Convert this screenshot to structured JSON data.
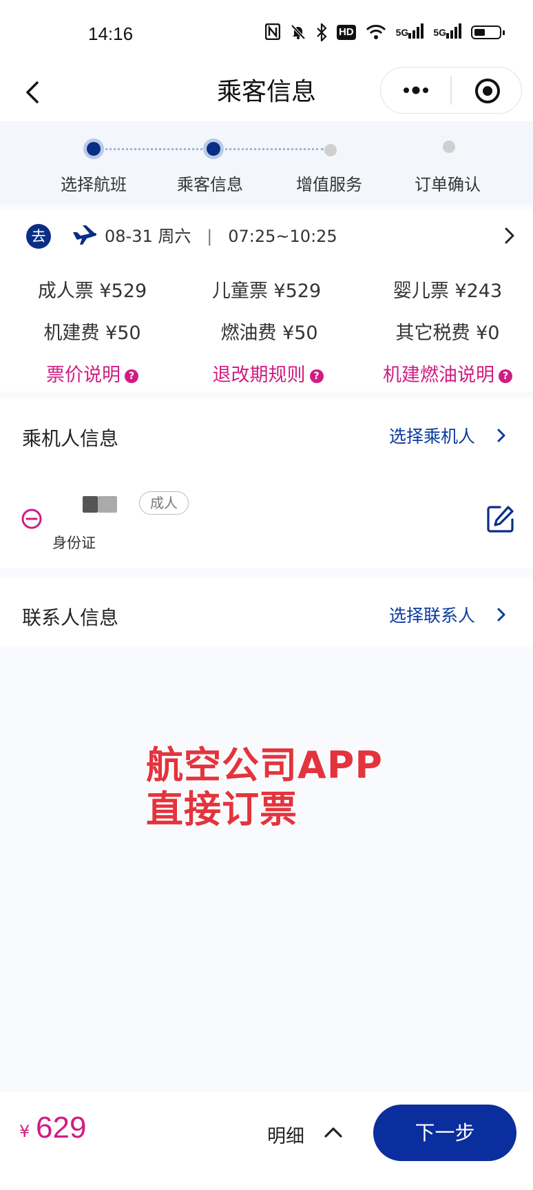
{
  "status_bar": {
    "time": "14:16",
    "icons": [
      "nfc-icon",
      "mute-icon",
      "bluetooth-icon",
      "hd-icon",
      "wifi-icon",
      "5g-signal-icon",
      "5g-signal-icon",
      "battery-icon"
    ],
    "hd_label": "HD",
    "net1": "5G",
    "net2": "5G",
    "battery_level": 0.45
  },
  "nav": {
    "title": "乘客信息"
  },
  "steps": [
    {
      "label": "选择航班",
      "state": "done"
    },
    {
      "label": "乘客信息",
      "state": "current"
    },
    {
      "label": "增值服务",
      "state": "todo"
    },
    {
      "label": "订单确认",
      "state": "todo"
    }
  ],
  "flight": {
    "direction": "去",
    "date": "08-31",
    "weekday": "周六",
    "separator": "|",
    "time": "07:25~10:25"
  },
  "prices": {
    "adult": "成人票 ¥529",
    "child": "儿童票 ¥529",
    "infant": "婴儿票 ¥243",
    "airport_fee": "机建费 ¥50",
    "fuel_fee": "燃油费 ¥50",
    "other_tax": "其它税费 ¥0",
    "link_fare": "票价说明",
    "link_rules": "退改期规则",
    "link_fees": "机建燃油说明",
    "qmark": "?"
  },
  "passenger_section": {
    "title": "乘机人信息",
    "action": "选择乘机人",
    "passenger": {
      "badge": "成人",
      "id_type": "身份证"
    }
  },
  "contact_section": {
    "title": "联系人信息",
    "action": "选择联系人"
  },
  "watermark": {
    "line1": "航空公司APP",
    "line2": "直接订票"
  },
  "bottom": {
    "currency": "¥",
    "total": "629",
    "detail": "明细",
    "next": "下一步"
  },
  "colors": {
    "brand": "#0a2e9e",
    "accent": "#d11c83",
    "step_done": "#0a2e86",
    "step_todo": "#cfcfcf"
  }
}
